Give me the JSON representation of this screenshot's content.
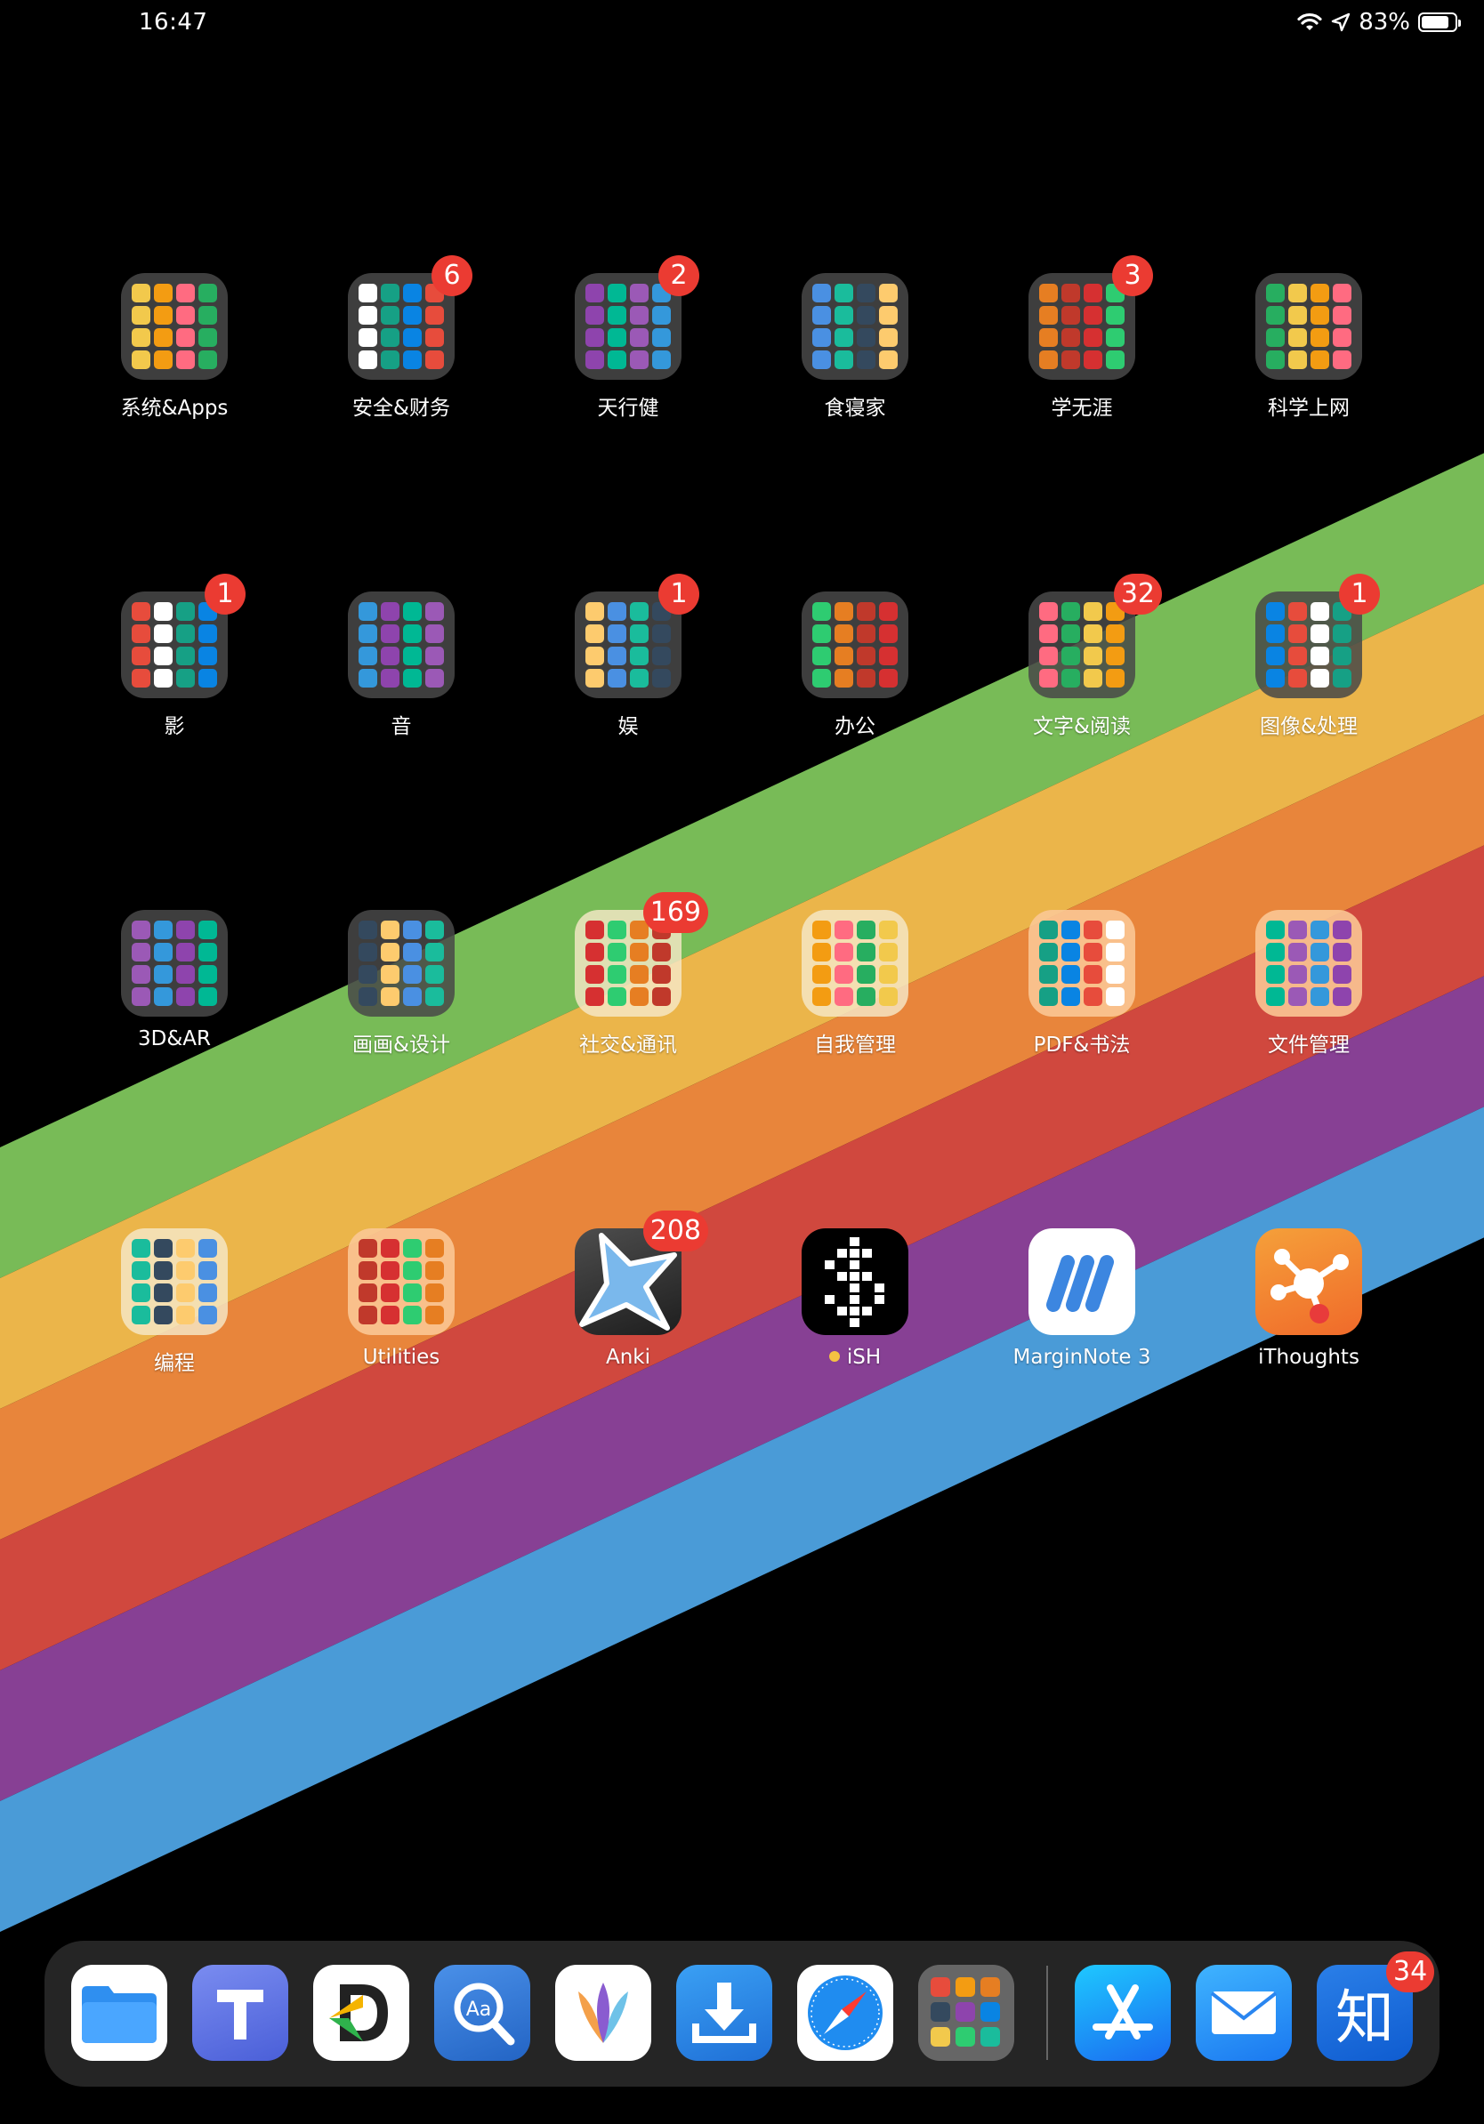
{
  "status_bar": {
    "time": "16:47",
    "battery_percent": "83%",
    "battery_level": 0.83,
    "icons": [
      "wifi-icon",
      "location-arrow-icon",
      "battery-icon"
    ]
  },
  "wallpaper": {
    "background": "#000000",
    "stripes": [
      "#78bb57",
      "#ebb54a",
      "#e8853b",
      "#d0483e",
      "#874094",
      "#4a9bd7"
    ]
  },
  "home_apps": [
    {
      "label": "系统&Apps",
      "type": "folder",
      "badge": "",
      "style": "dark"
    },
    {
      "label": "安全&财务",
      "type": "folder",
      "badge": "6",
      "style": "dark"
    },
    {
      "label": "天行健",
      "type": "folder",
      "badge": "2",
      "style": "dark"
    },
    {
      "label": "食寝家",
      "type": "folder",
      "badge": "",
      "style": "dark"
    },
    {
      "label": "学无涯",
      "type": "folder",
      "badge": "3",
      "style": "dark"
    },
    {
      "label": "科学上网",
      "type": "folder",
      "badge": "",
      "style": "dark"
    },
    {
      "label": "影",
      "type": "folder",
      "badge": "1",
      "style": "dark"
    },
    {
      "label": "音",
      "type": "folder",
      "badge": "",
      "style": "dark"
    },
    {
      "label": "娱",
      "type": "folder",
      "badge": "1",
      "style": "dark"
    },
    {
      "label": "办公",
      "type": "folder",
      "badge": "",
      "style": "dark"
    },
    {
      "label": "文字&阅读",
      "type": "folder",
      "badge": "32",
      "style": "dark"
    },
    {
      "label": "图像&处理",
      "type": "folder",
      "badge": "1",
      "style": "dark"
    },
    {
      "label": "3D&AR",
      "type": "folder",
      "badge": "",
      "style": "dark"
    },
    {
      "label": "画画&设计",
      "type": "folder",
      "badge": "",
      "style": "dark"
    },
    {
      "label": "社交&通讯",
      "type": "folder",
      "badge": "169",
      "style": "light"
    },
    {
      "label": "自我管理",
      "type": "folder",
      "badge": "",
      "style": "light"
    },
    {
      "label": "PDF&书法",
      "type": "folder",
      "badge": "",
      "style": "peach"
    },
    {
      "label": "文件管理",
      "type": "folder",
      "badge": "",
      "style": "peach"
    },
    {
      "label": "编程",
      "type": "folder",
      "badge": "",
      "style": "light"
    },
    {
      "label": "Utilities",
      "type": "folder",
      "badge": "",
      "style": "peach"
    },
    {
      "label": "Anki",
      "type": "app",
      "badge": "208",
      "icon": "anki-star-icon"
    },
    {
      "label": "iSH",
      "type": "app",
      "badge": "",
      "icon": "ish-dollar-icon",
      "status_dot": "#f5c242"
    },
    {
      "label": "MarginNote 3",
      "type": "app",
      "badge": "",
      "icon": "marginnote-icon"
    },
    {
      "label": "iThoughts",
      "type": "app",
      "badge": "",
      "icon": "ithoughts-mindmap-icon"
    }
  ],
  "dock": {
    "apps": [
      {
        "name": "files-app",
        "icon": "files-folder-icon",
        "badge": ""
      },
      {
        "name": "typeeto-app",
        "icon": "letter-t-icon",
        "badge": ""
      },
      {
        "name": "documents-app",
        "icon": "documents-d-icon",
        "badge": ""
      },
      {
        "name": "dictionary-app",
        "icon": "dictionary-aa-icon",
        "badge": ""
      },
      {
        "name": "mindnode-app",
        "icon": "mindnode-leaf-icon",
        "badge": ""
      },
      {
        "name": "downloader-app",
        "icon": "download-tray-icon",
        "badge": ""
      },
      {
        "name": "safari-app",
        "icon": "safari-compass-icon",
        "badge": ""
      },
      {
        "name": "dock-folder",
        "icon": "folder-grid-icon",
        "badge": ""
      },
      {
        "name": "app-store-app",
        "icon": "app-store-icon",
        "badge": ""
      },
      {
        "name": "mail-app",
        "icon": "mail-envelope-icon",
        "badge": ""
      },
      {
        "name": "zhihu-app",
        "icon": "zhihu-icon",
        "badge": "34",
        "glyph": "知"
      }
    ]
  }
}
